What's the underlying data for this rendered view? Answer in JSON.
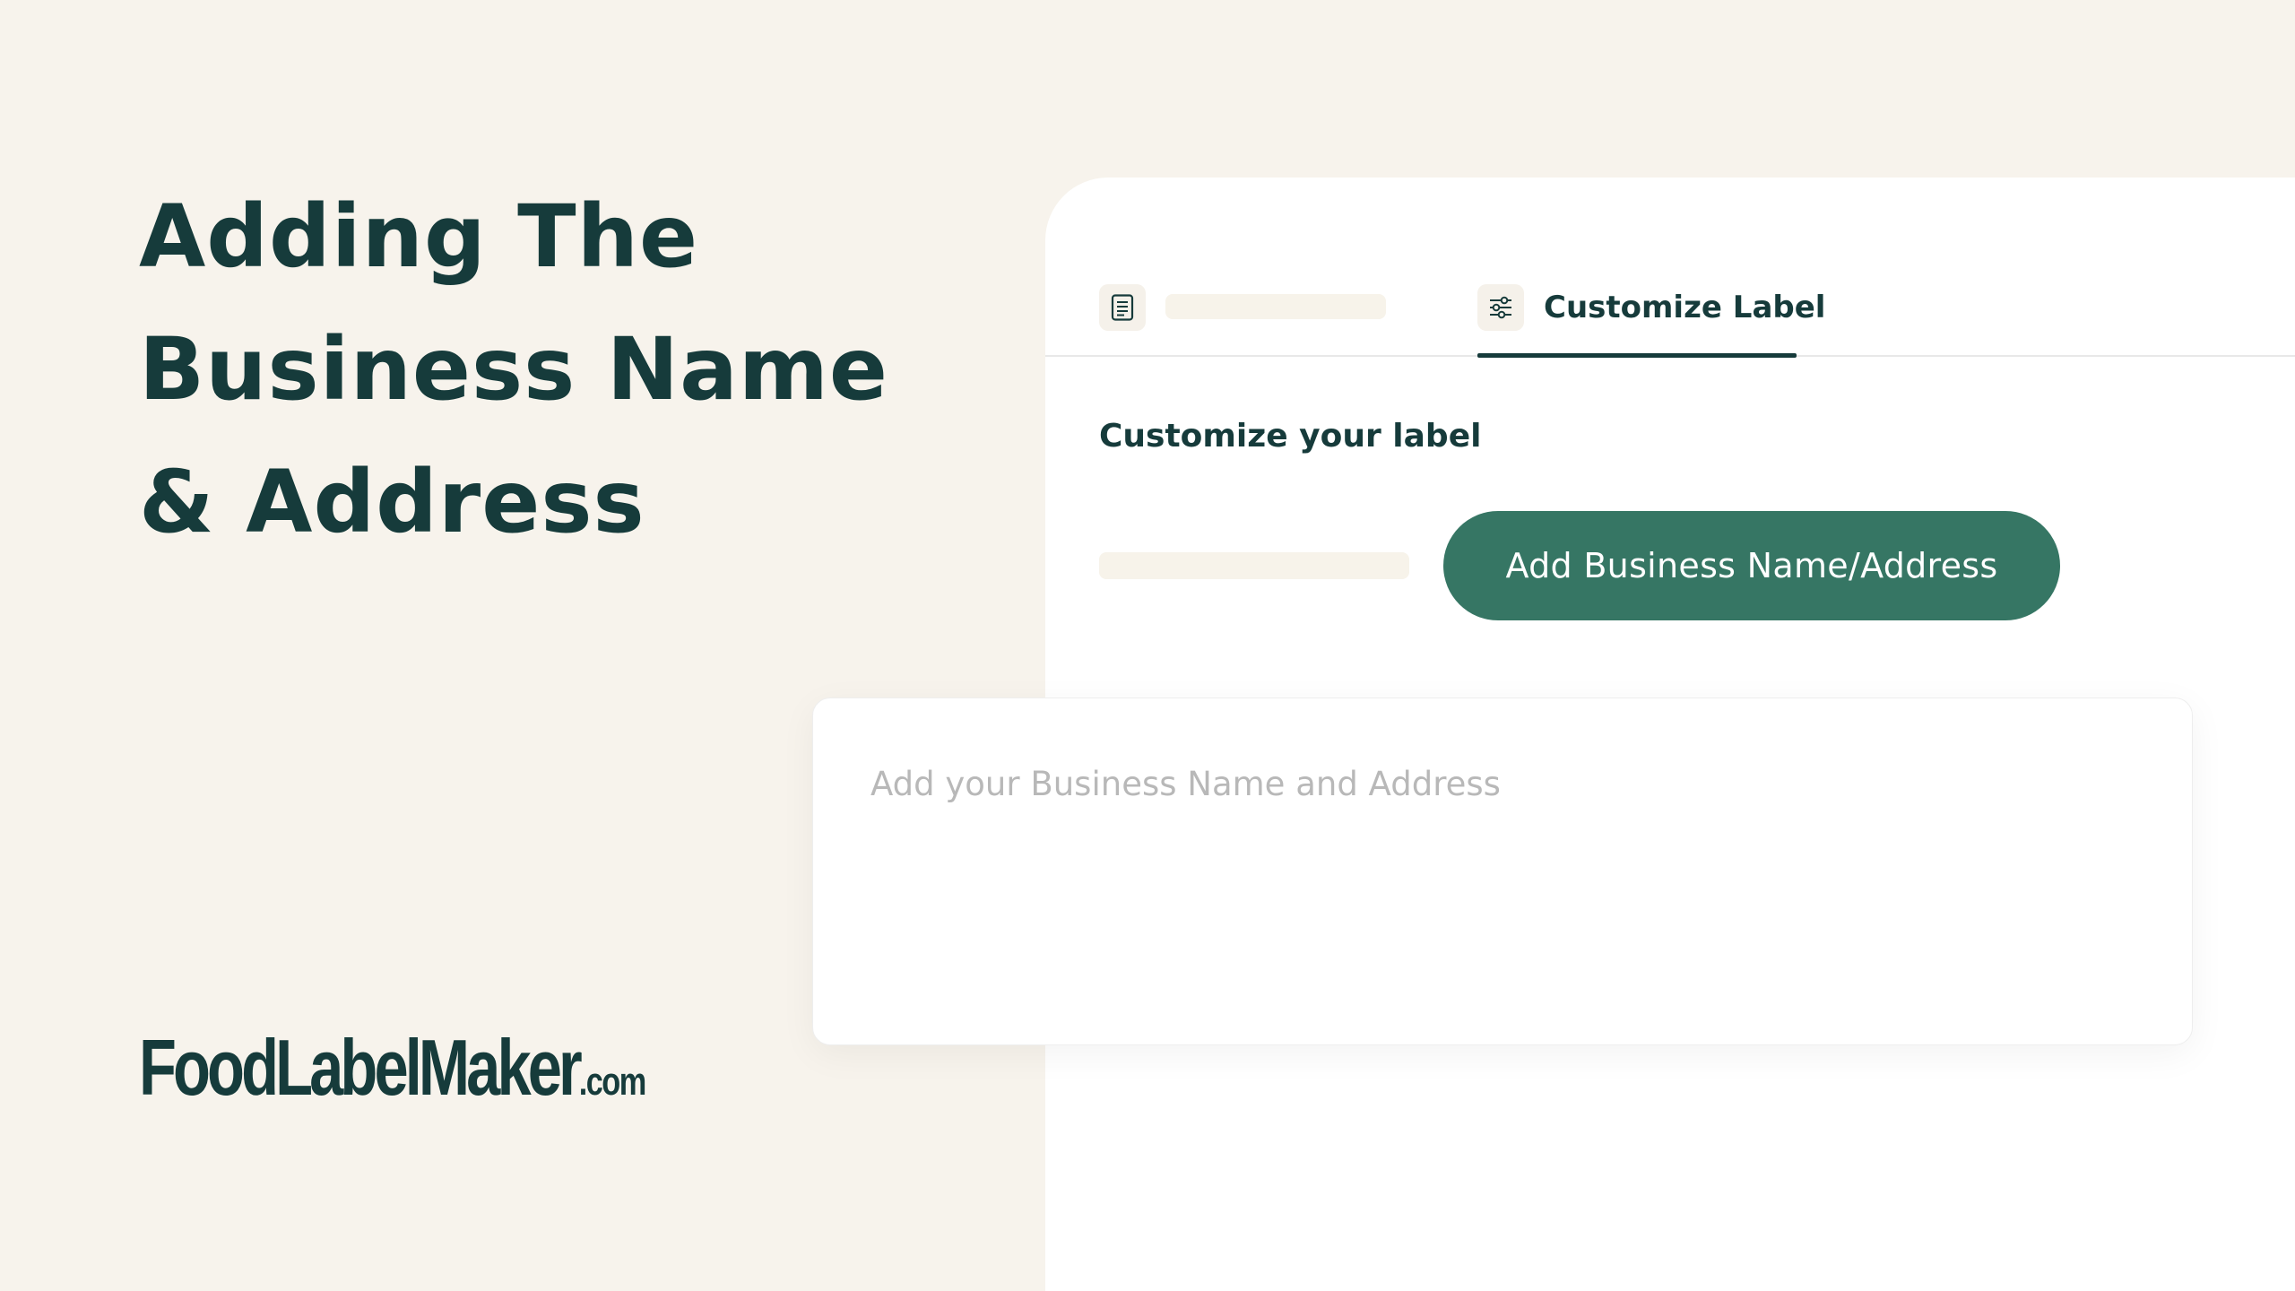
{
  "headline": {
    "line1": "Adding The",
    "line2": "Business Name",
    "line3": "& Address"
  },
  "logo": {
    "main": "FoodLabelMaker",
    "tld": ".com"
  },
  "tabs": {
    "first": {
      "icon": "document-icon",
      "label": ""
    },
    "second": {
      "icon": "sliders-icon",
      "label": "Customize Label",
      "active": true
    }
  },
  "section": {
    "title": "Customize your label"
  },
  "add_button": {
    "label": "Add Business Name/Address",
    "color": "#367664"
  },
  "address_input": {
    "value": "",
    "placeholder": "Add your Business Name and Address"
  },
  "colors": {
    "background": "#f7f3ec",
    "text_dark": "#163b3b",
    "accent": "#367664"
  }
}
